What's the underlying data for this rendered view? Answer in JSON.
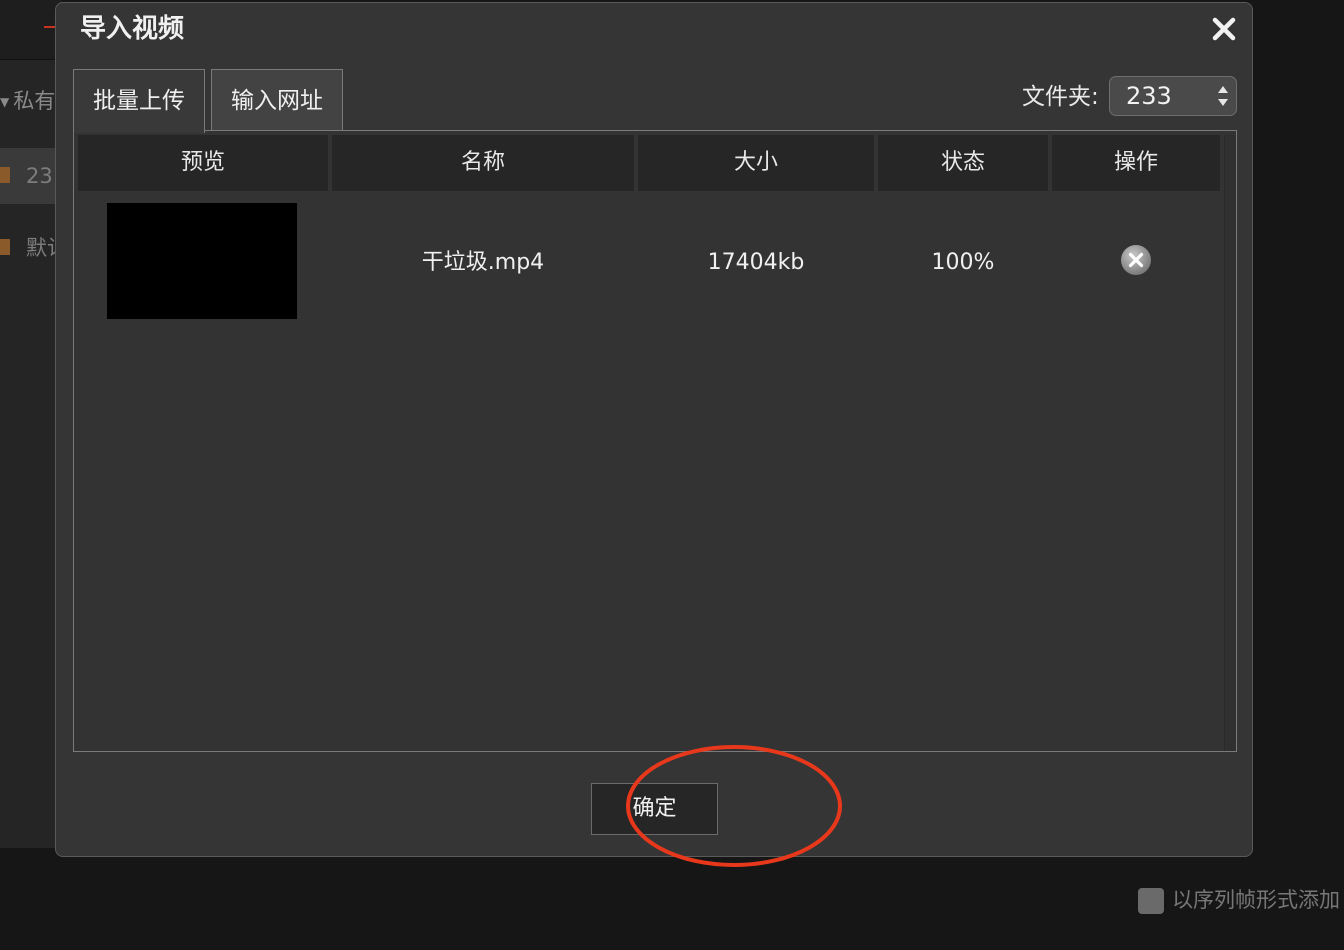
{
  "background": {
    "section_label": "私有",
    "items": [
      {
        "label": "23",
        "selected": true
      },
      {
        "label": "默认",
        "selected": false
      }
    ],
    "sequence_option_label": "以序列帧形式添加"
  },
  "dialog": {
    "title": "导入视频",
    "close_icon": "close-icon",
    "tabs": [
      {
        "label": "批量上传",
        "active": true
      },
      {
        "label": "输入网址",
        "active": false
      }
    ],
    "folder": {
      "label": "文件夹:",
      "selected": "233"
    },
    "table": {
      "columns": [
        "预览",
        "名称",
        "大小",
        "状态",
        "操作"
      ],
      "rows": [
        {
          "name": "干垃圾.mp4",
          "size": "17404kb",
          "status": "100%",
          "action_icon": "remove-circle-icon"
        }
      ]
    },
    "confirm_label": "确定"
  },
  "colors": {
    "dialog_bg": "#353535",
    "header_bg": "#262626",
    "annotation": "#e8381c",
    "folder_icon": "#8b5a2b"
  }
}
